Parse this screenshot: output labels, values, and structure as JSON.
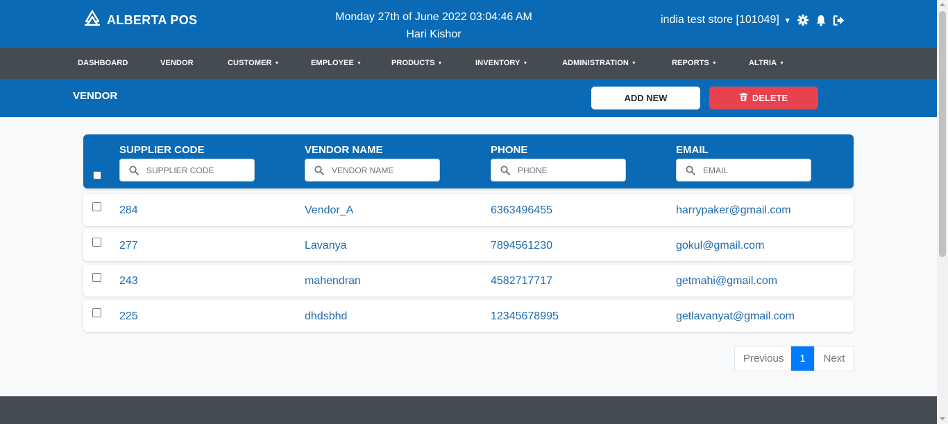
{
  "app": {
    "logo_text": "ALBERTA POS",
    "datetime": "Monday 27th of June 2022 03:04:46 AM",
    "user": "Hari Kishor",
    "store": "india test store [101049]"
  },
  "nav": {
    "items": [
      {
        "label": "DASHBOARD",
        "caret": false
      },
      {
        "label": "VENDOR",
        "caret": false
      },
      {
        "label": "CUSTOMER",
        "caret": true
      },
      {
        "label": "EMPLOYEE",
        "caret": true
      },
      {
        "label": "PRODUCTS",
        "caret": true
      },
      {
        "label": "INVENTORY",
        "caret": true
      },
      {
        "label": "ADMINISTRATION",
        "caret": true
      },
      {
        "label": "REPORTS",
        "caret": true
      },
      {
        "label": "ALTRIA",
        "caret": true
      }
    ]
  },
  "page": {
    "title": "VENDOR",
    "add_label": "ADD NEW",
    "delete_label": "DELETE"
  },
  "table": {
    "columns": [
      {
        "label": "SUPPLIER CODE",
        "placeholder": "SUPPLIER CODE"
      },
      {
        "label": "VENDOR NAME",
        "placeholder": "VENDOR NAME"
      },
      {
        "label": "PHONE",
        "placeholder": "PHONE"
      },
      {
        "label": "EMAIL",
        "placeholder": "EMAIL"
      }
    ],
    "rows": [
      {
        "code": "284",
        "name": "Vendor_A",
        "phone": "6363496455",
        "email": "harrypaker@gmail.com"
      },
      {
        "code": "277",
        "name": "Lavanya",
        "phone": "7894561230",
        "email": "gokul@gmail.com"
      },
      {
        "code": "243",
        "name": "mahendran",
        "phone": "4582717717",
        "email": "getmahi@gmail.com"
      },
      {
        "code": "225",
        "name": "dhdsbhd",
        "phone": "12345678995",
        "email": "getlavanyat@gmail.com"
      }
    ]
  },
  "pagination": {
    "prev": "Previous",
    "current": "1",
    "next": "Next"
  },
  "colors": {
    "primary": "#0a6ab5",
    "nav": "#454b52",
    "danger": "#e6434f",
    "link": "#1e6bb0",
    "active_page": "#007bff"
  },
  "icons": {
    "logo": "alberta-logo-icon",
    "store_caret": "caret-down-icon",
    "settings": "gear-icon",
    "notifications": "bell-icon",
    "logout": "sign-out-icon",
    "delete": "trash-icon",
    "search": "search-icon"
  }
}
